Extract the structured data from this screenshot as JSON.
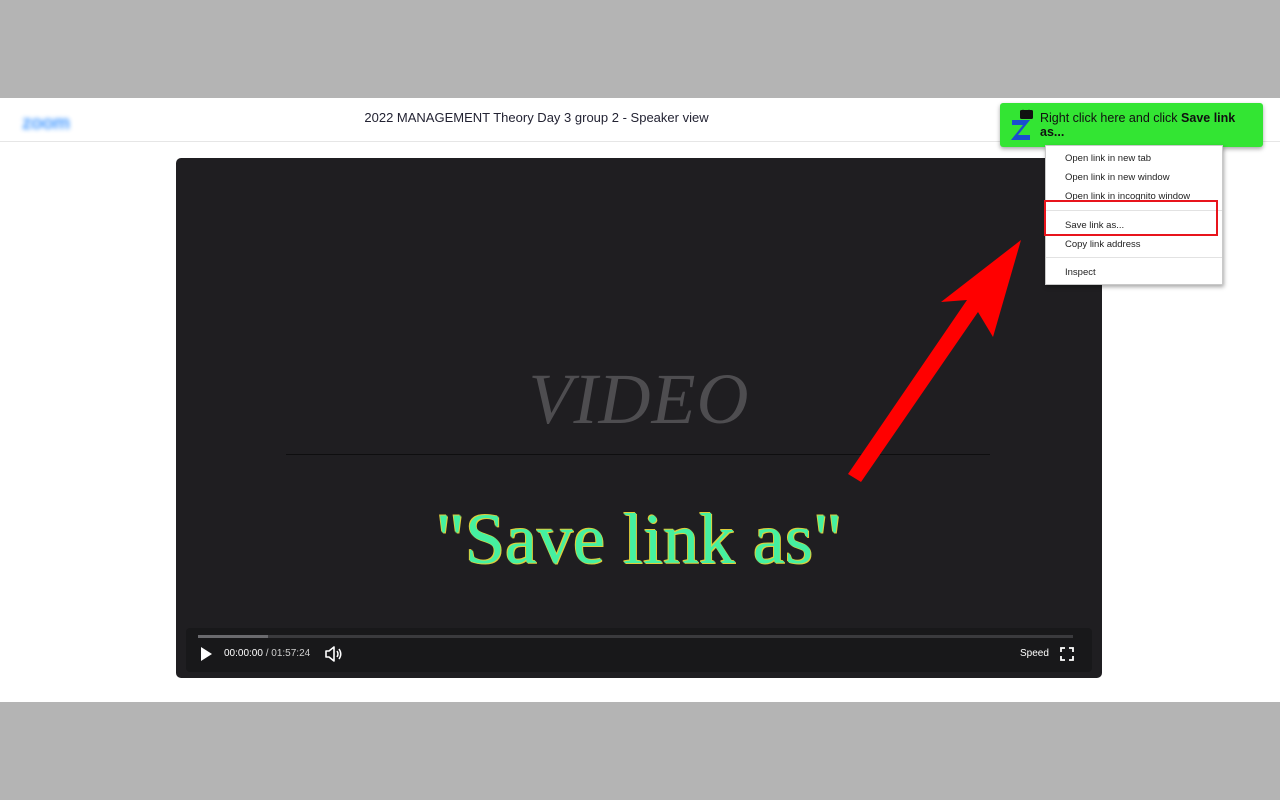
{
  "header": {
    "logo": "zoom",
    "title_main": "2022 MANAGEMENT Theory Day 3 group 2",
    "title_separator": " - ",
    "title_view": "Speaker view"
  },
  "download_button": {
    "icon": "zoom-download-icon",
    "text_prefix": "Right click here and click ",
    "text_bold": "Save link as..."
  },
  "context_menu": {
    "items": [
      "Open link in new tab",
      "Open link in new window",
      "Open link in incognito window",
      "Save link as...",
      "Copy link address",
      "Inspect"
    ],
    "highlighted": "Save link as..."
  },
  "video": {
    "placeholder_label": "VIDEO",
    "caption": "\"Save link as\"",
    "current_time": "00:00:00",
    "time_separator": " / ",
    "duration": "01:57:24",
    "speed_label": "Speed",
    "progress": 0.08
  },
  "colors": {
    "button_green": "#33e533",
    "highlight_red": "#e8141c",
    "arrow_red": "#ff0000",
    "caption_green": "#45f0a0"
  }
}
